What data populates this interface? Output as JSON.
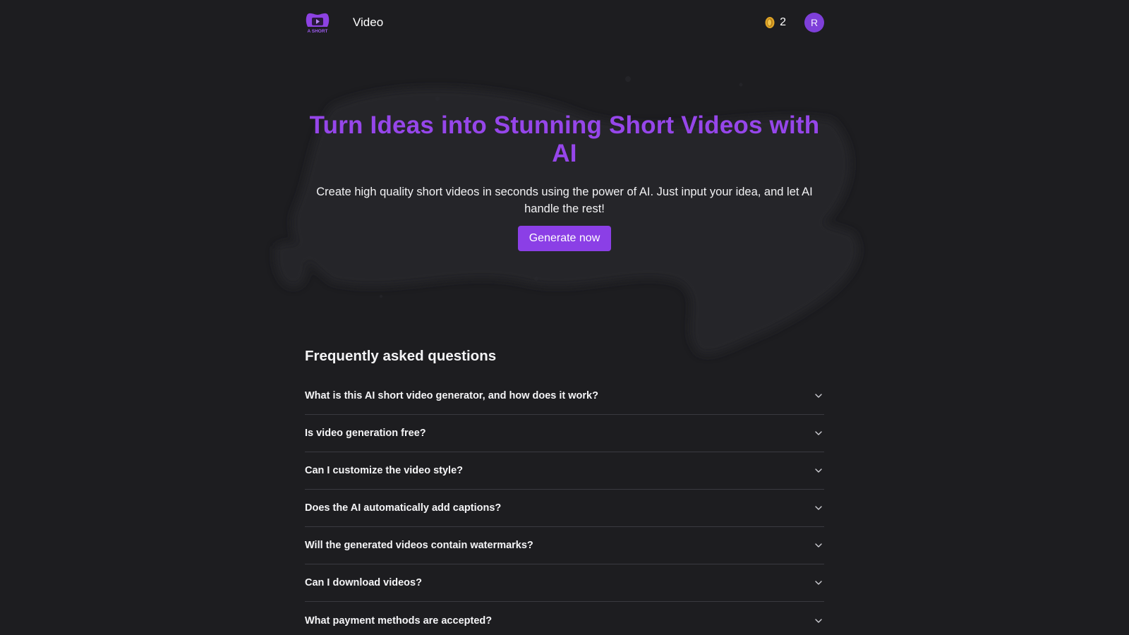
{
  "header": {
    "logo_icon": "a-short-logo-icon",
    "logo_text": "A SHORT",
    "nav_video": "Video",
    "coin_icon": "coin-icon",
    "coin_count": "2",
    "avatar_initial": "R"
  },
  "hero": {
    "title": "Turn Ideas into Stunning Short Videos with AI",
    "subtitle": "Create high quality short videos in seconds using the power of AI. Just input your idea, and let AI handle the rest!",
    "cta_label": "Generate now"
  },
  "faq": {
    "heading": "Frequently asked questions",
    "items": [
      {
        "question": "What is this AI short video generator, and how does it work?"
      },
      {
        "question": "Is video generation free?"
      },
      {
        "question": "Can I customize the video style?"
      },
      {
        "question": "Does the AI automatically add captions?"
      },
      {
        "question": "Will the generated videos contain watermarks?"
      },
      {
        "question": "Can I download videos?"
      },
      {
        "question": "What payment methods are accepted?"
      }
    ]
  },
  "colors": {
    "background": "#1d1d20",
    "accent": "#8b3fe6",
    "title_purple": "#9646ea",
    "avatar": "#7e3fd9",
    "coin": "#e0a526"
  }
}
